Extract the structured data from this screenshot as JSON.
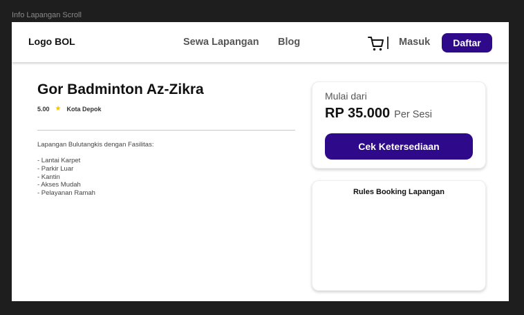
{
  "frame_label": "Info Lapangan Scroll",
  "navbar": {
    "logo": "Logo BOL",
    "links": [
      "Sewa Lapangan",
      "Blog"
    ],
    "cart_icon": "cart-icon",
    "login": "Masuk",
    "register": "Daftar"
  },
  "venue": {
    "title": "Gor Badminton Az-Zikra",
    "rating": "5.00",
    "city": "Kota Depok",
    "description_heading": "Lapangan Bulutangkis dengan Fasilitas:",
    "facilities": [
      "- Lantai Karpet",
      "- Parkir Luar",
      "- Kantin",
      "- Akses Mudah",
      "- Pelayanan Ramah"
    ]
  },
  "price_card": {
    "label": "Mulai dari",
    "price": "RP 35.000",
    "unit": "Per Sesi",
    "button": "Cek Ketersediaan"
  },
  "rules_card": {
    "title": "Rules Booking Lapangan"
  },
  "colors": {
    "primary": "#2e0a8a",
    "star": "#f5c400",
    "background": "#1e1e1e"
  }
}
